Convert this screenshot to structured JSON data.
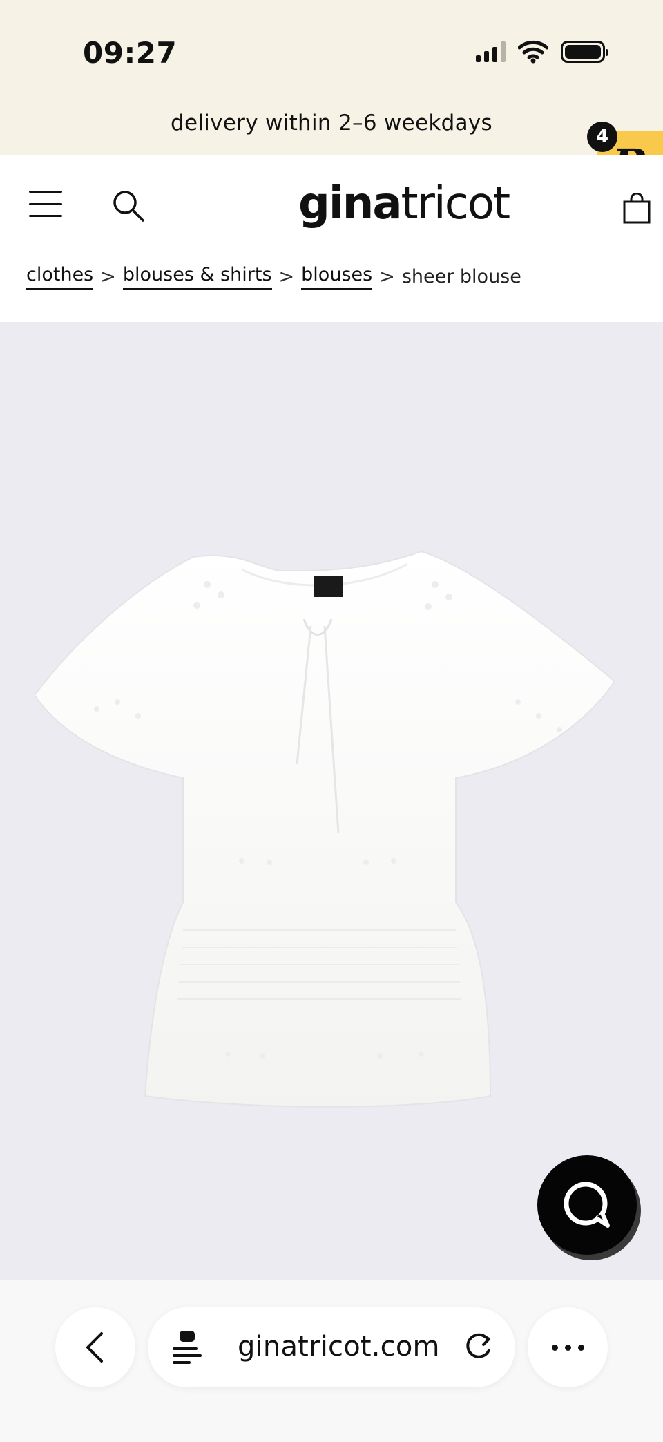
{
  "status_bar": {
    "time": "09:27"
  },
  "promo": {
    "text": "delivery within 2–6 weekdays"
  },
  "badge": {
    "letter": "R",
    "count": "4",
    "color": "#f8c94a"
  },
  "header": {
    "logo_bold": "gina",
    "logo_light": "tricot",
    "icons": [
      "menu-icon",
      "search-icon",
      "shopping-bag-icon"
    ]
  },
  "breadcrumb": {
    "items": [
      {
        "label": "clothes",
        "link": true
      },
      {
        "label": "blouses & shirts",
        "link": true
      },
      {
        "label": "blouses",
        "link": true
      },
      {
        "label": "sheer blouse",
        "link": false
      }
    ],
    "separator": ">"
  },
  "product": {
    "image_icon": "white-blouse-image",
    "background": "#ebebf1"
  },
  "chat": {
    "icon": "chat-bubble-icon"
  },
  "browser": {
    "url": "ginatricot.com",
    "icons": [
      "back-chevron-icon",
      "page-icon",
      "reload-icon",
      "more-icon"
    ]
  },
  "colors": {
    "top_band": "#f6f2e6",
    "text": "#111111"
  }
}
